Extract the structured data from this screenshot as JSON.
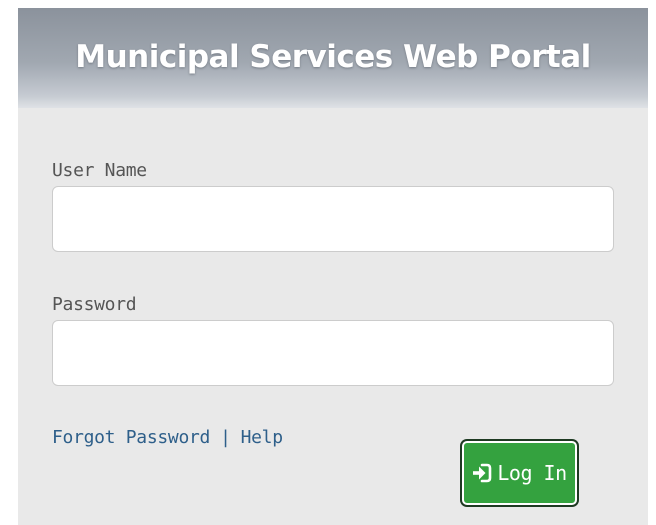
{
  "header": {
    "title": "Municipal Services Web Portal"
  },
  "form": {
    "username": {
      "label": "User Name",
      "value": "",
      "placeholder": ""
    },
    "password": {
      "label": "Password",
      "value": "",
      "placeholder": ""
    }
  },
  "links": {
    "forgot_password": "Forgot Password",
    "separator": "|",
    "help": "Help"
  },
  "login_button": {
    "label": "Log In",
    "icon": "sign-in-icon"
  },
  "colors": {
    "header_gradient_top": "#8b929c",
    "panel_background": "#e9e9e9",
    "link_color": "#2e5f8a",
    "button_green": "#34a23f"
  }
}
